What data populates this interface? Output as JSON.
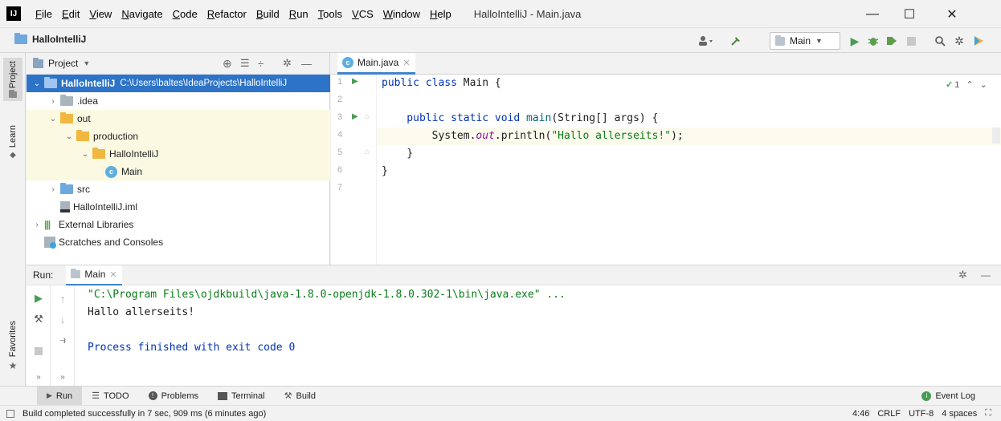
{
  "menu": {
    "logo": "IJ",
    "items": [
      "File",
      "Edit",
      "View",
      "Navigate",
      "Code",
      "Refactor",
      "Build",
      "Run",
      "Tools",
      "VCS",
      "Window",
      "Help"
    ],
    "window_title": "HalloIntelliJ - Main.java",
    "minimize": "—",
    "maximize": "☐",
    "close": "✕"
  },
  "navbar": {
    "project_name": "HalloIntelliJ",
    "run_config": "Main"
  },
  "left_stripe": {
    "project": "Project",
    "learn": "Learn",
    "favorites": "Favorites"
  },
  "project_panel": {
    "header": "Project",
    "tree": [
      {
        "label": "HalloIntelliJ",
        "path": "C:\\Users\\baltes\\IdeaProjects\\HalloIntelliJ",
        "indent": 0,
        "arrow": "⌄",
        "icon": "module-folder"
      },
      {
        "label": ".idea",
        "indent": 1,
        "arrow": "›",
        "icon": "folder"
      },
      {
        "label": "out",
        "indent": 1,
        "arrow": "⌄",
        "icon": "excluded-folder"
      },
      {
        "label": "production",
        "indent": 2,
        "arrow": "⌄",
        "icon": "excluded-folder"
      },
      {
        "label": "HalloIntelliJ",
        "indent": 3,
        "arrow": "⌄",
        "icon": "excluded-folder"
      },
      {
        "label": "Main",
        "indent": 4,
        "arrow": "",
        "icon": "class"
      },
      {
        "label": "src",
        "indent": 1,
        "arrow": "›",
        "icon": "source-folder"
      },
      {
        "label": "HalloIntelliJ.iml",
        "indent": 1,
        "arrow": "",
        "icon": "iml-file"
      },
      {
        "label": "External Libraries",
        "indent": 0,
        "arrow": "›",
        "icon": "libraries"
      },
      {
        "label": "Scratches and Consoles",
        "indent": 0,
        "arrow": "",
        "icon": "scratches"
      }
    ]
  },
  "editor": {
    "tab_label": "Main.java",
    "inspection_count": "1",
    "line_numbers": [
      "1",
      "2",
      "3",
      "4",
      "5",
      "6",
      "7"
    ],
    "code": {
      "l1_kw": "public class ",
      "l1_rest": "Main {",
      "l3_kw": "    public static void ",
      "l3_meth": "main",
      "l3_rest": "(String[] args) {",
      "l4_pre": "        System.",
      "l4_fld": "out",
      "l4_mid": ".println(",
      "l4_str": "\"Hallo allerseits!\"",
      "l4_end": ");",
      "l5": "    }",
      "l6": "}"
    }
  },
  "run_panel": {
    "label": "Run:",
    "tab": "Main",
    "command": "\"C:\\Program Files\\ojdkbuild\\java-1.8.0-openjdk-1.8.0.302-1\\bin\\java.exe\" ...",
    "output": "Hallo allerseits!",
    "exit": "Process finished with exit code 0"
  },
  "bottom_tabs": [
    "Run",
    "TODO",
    "Problems",
    "Terminal",
    "Build"
  ],
  "event_log": "Event Log",
  "status": {
    "message": "Build completed successfully in 7 sec, 909 ms (6 minutes ago)",
    "position": "4:46",
    "line_sep": "CRLF",
    "encoding": "UTF-8",
    "indent": "4 spaces"
  },
  "colors": {
    "selection": "#d5e1f2",
    "excluded_bg": "#fbf9e2",
    "accent": "#4083c9",
    "run_green": "#499c54"
  }
}
